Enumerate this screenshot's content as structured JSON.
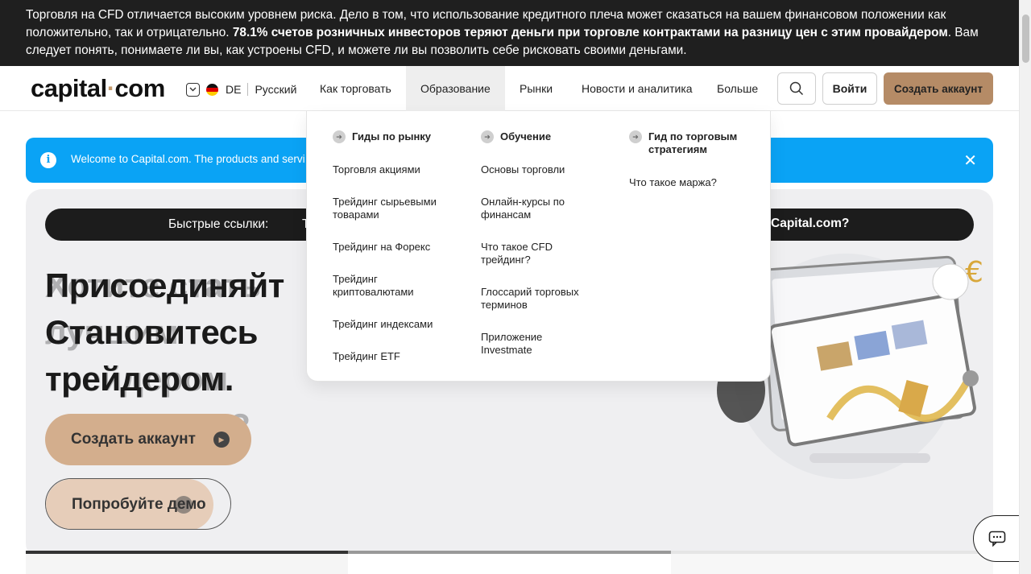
{
  "risk_banner": {
    "text_before": "Торговля на CFD отличается высоким уровнем риска. Дело в том, что использование кредитного плеча может сказаться на вашем финансовом положении как положительно, так и отрицательно. ",
    "text_bold": "78.1% счетов розничных инвесторов теряют деньги при торговле контрактами на разницу цен с этим провайдером",
    "text_after": ". Вам следует понять, понимаете ли вы, как устроены CFD, и можете ли вы позволить себе рисковать своими деньгами."
  },
  "header": {
    "logo_left": "capital",
    "logo_dot": "·",
    "logo_right": "com",
    "region_code": "DE",
    "language": "Русский",
    "nav": [
      "Как торговать",
      "Образование",
      "Рынки",
      "Новости и аналитика",
      "Больше"
    ],
    "login_label": "Войти",
    "signup_label": "Создать аккаунт"
  },
  "info_strip": {
    "icon": "info-icon",
    "text": "Welcome to Capital.com. The products and services",
    "close": "✕"
  },
  "quick_links": {
    "label": "Быстрые ссылки:",
    "partial_left": "Т",
    "right": "Capital.com?"
  },
  "hero": {
    "title_line1": "Присоединяйт",
    "title_line2": "Становитесь",
    "title_line3": "трейдером.",
    "ghost_line1": "Хотите стать",
    "ghost_line2": "лучшим трейдером",
    "ghost_line3": "сего?",
    "cta_label": "Создать аккаунт",
    "demo_label": "Попробуйте демо"
  },
  "dropdown": {
    "columns": [
      {
        "heading": "Гиды по рынку",
        "links": [
          "Торговля акциями",
          "Трейдинг сырьевыми товарами",
          "Трейдинг на Форекс",
          "Трейдинг криптовалютами",
          "Трейдинг индексами",
          "Трейдинг ETF"
        ]
      },
      {
        "heading": "Обучение",
        "links": [
          "Основы торговли",
          "Онлайн-курсы по финансам",
          "Что такое CFD трейдинг?",
          "Глоссарий торговых терминов",
          "Приложение Investmate"
        ]
      },
      {
        "heading": "Гид по торговым стратегиям",
        "links": [
          "Что такое маржа?"
        ]
      }
    ]
  },
  "colors": {
    "banner_bg": "#1f1f1f",
    "accent_gold": "#b58b66",
    "info_blue": "#0aa3f5",
    "hero_bg": "#efeff1"
  }
}
